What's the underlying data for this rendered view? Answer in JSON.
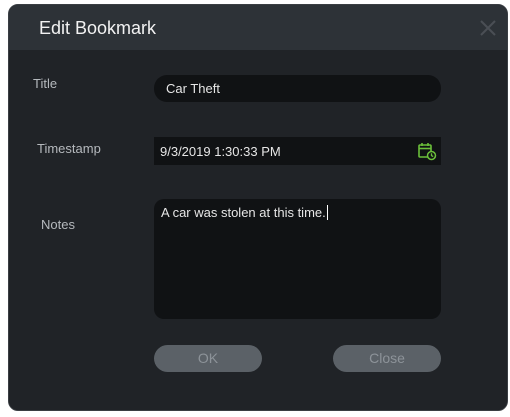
{
  "dialog": {
    "title": "Edit Bookmark",
    "close_icon": "close-icon"
  },
  "fields": {
    "title_label": "Title",
    "title_value": "Car Theft",
    "timestamp_label": "Timestamp",
    "timestamp_value": "9/3/2019 1:30:33 PM",
    "timestamp_icon": "calendar-clock-icon",
    "notes_label": "Notes",
    "notes_value": "A car was stolen at this time."
  },
  "buttons": {
    "ok_label": "OK",
    "close_label": "Close"
  },
  "colors": {
    "accent": "#6bbf3a",
    "dialog_bg": "#202327",
    "titlebar_bg": "#2d3237",
    "input_bg": "#101214",
    "button_bg": "#5b6167"
  }
}
